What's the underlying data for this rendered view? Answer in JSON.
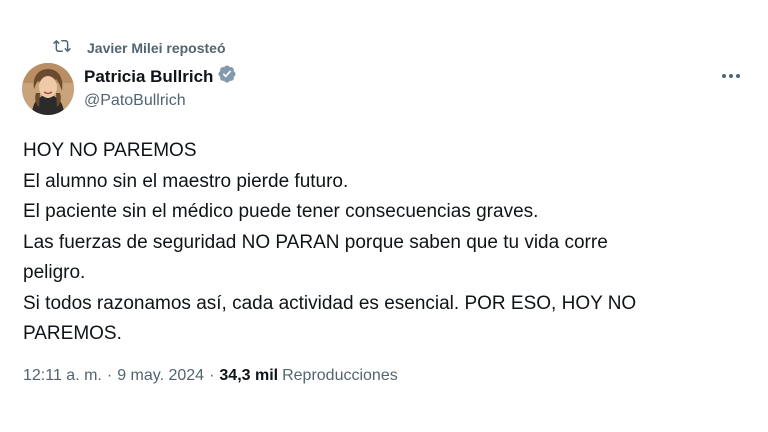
{
  "repost": {
    "label": "Javier Milei reposteó",
    "icon": "repost-icon"
  },
  "author": {
    "name": "Patricia Bullrich",
    "handle": "@PatoBullrich",
    "verified_color": "#829aab"
  },
  "tweet": {
    "lines": [
      "HOY NO PAREMOS",
      "El alumno sin el maestro pierde futuro.",
      "El paciente sin el médico puede tener consecuencias graves.",
      "Las fuerzas de seguridad NO PARAN porque saben que tu vida corre",
      "peligro.",
      "Si todos razonamos así, cada actividad es esencial. POR ESO, HOY NO",
      "PAREMOS."
    ]
  },
  "meta": {
    "time": "12:11 a. m.",
    "separator1": "·",
    "date": "9 may. 2024",
    "separator2": "·",
    "views_count": "34,3 mil",
    "views_label": "Reproducciones"
  },
  "icons": {
    "more": "more-icon",
    "verified": "verified-badge-icon"
  }
}
